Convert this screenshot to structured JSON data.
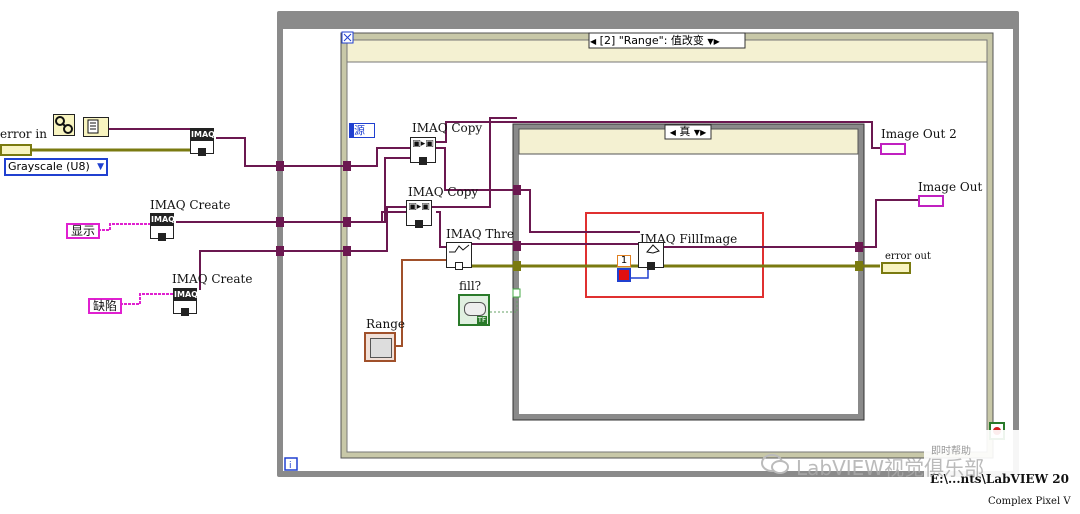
{
  "labels": {
    "error_in": "error in",
    "grayscale": "Grayscale (U8)",
    "imaq": "IMAQ",
    "imaq_create_1": "IMAQ Create",
    "imaq_create_2": "IMAQ Create",
    "display_const": "显示",
    "defect_const": "缺陷",
    "source_label": "源",
    "imaq_copy_1": "IMAQ Copy",
    "imaq_copy_2": "IMAQ Copy",
    "imaq_threshold": "IMAQ Thre",
    "imaq_fillimage": "IMAQ FillImage",
    "fill": "fill?",
    "range": "Range",
    "image_out_2": "Image Out 2",
    "image_out": "Image Out",
    "error_out": "error out",
    "numeric_const": "1",
    "tf": "TF",
    "event_selector": "[2] \"Range\": 值改变",
    "case_selector": "真",
    "watermark": "LabVIEW视觉俱乐部",
    "help_label": "即时帮助",
    "path_text": "E:\\...nts\\LabVIEW 20",
    "help_footer": "Complex Pixel V"
  },
  "colors": {
    "image_wire": "#6b1850",
    "error_wire": "#7a7a10",
    "numeric_wire": "#2040d0",
    "string_const": "#e020d0",
    "highlight_box": "#e03030"
  }
}
